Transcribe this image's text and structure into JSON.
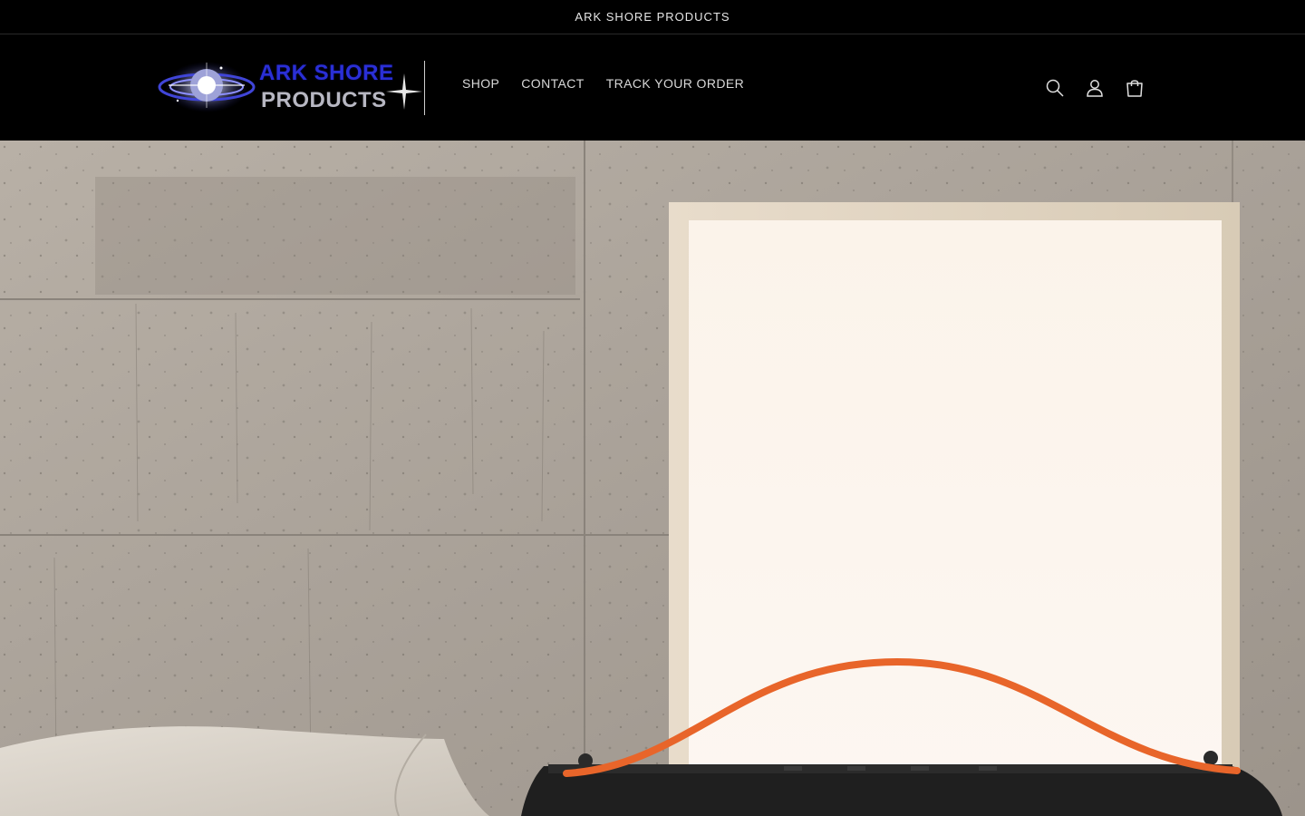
{
  "announcement": {
    "text": "ARK SHORE PRODUCTS"
  },
  "logo": {
    "line1": "ARK SHORE",
    "line2": "PRODUCTS"
  },
  "nav": {
    "items": [
      {
        "label": "SHOP"
      },
      {
        "label": "CONTACT"
      },
      {
        "label": "TRACK YOUR ORDER"
      }
    ]
  },
  "header_icons": [
    "search-icon",
    "account-icon",
    "cart-icon"
  ],
  "colors": {
    "background": "#000000",
    "logo_blue": "#2a2fd6",
    "logo_grey": "#b7b7c2",
    "strap_orange": "#e8652a"
  }
}
